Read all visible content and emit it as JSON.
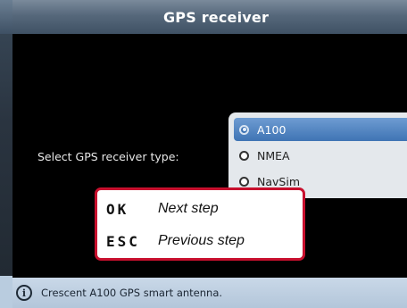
{
  "window": {
    "title": "GPS receiver"
  },
  "form": {
    "prompt": "Select GPS receiver type:",
    "options": [
      {
        "label": "A100",
        "selected": true
      },
      {
        "label": "NMEA",
        "selected": false
      },
      {
        "label": "NavSim",
        "selected": false
      }
    ]
  },
  "hints": [
    {
      "key": "OK",
      "text": "Next step"
    },
    {
      "key": "ESC",
      "text": "Previous step"
    }
  ],
  "status": {
    "icon": "info-icon",
    "text": "Crescent A100 GPS smart antenna."
  },
  "colors": {
    "accent": "#3f74b4",
    "hint_border": "#c8102e"
  }
}
